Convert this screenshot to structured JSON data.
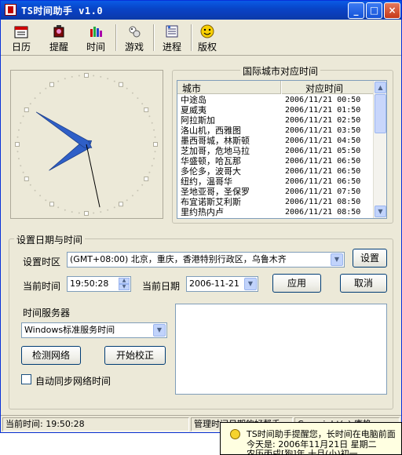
{
  "window": {
    "title": "TS时间助手  v1.0"
  },
  "title_buttons": {
    "minimize": "_",
    "maximize": "□",
    "close": "×"
  },
  "toolbar": [
    {
      "id": "calendar",
      "label": "日历",
      "icon": "calendar-icon"
    },
    {
      "id": "remind",
      "label": "提醒",
      "icon": "alarm-icon"
    },
    {
      "id": "time",
      "label": "时间",
      "icon": "bar-chart-icon"
    },
    {
      "id": "game",
      "label": "游戏",
      "icon": "game-icon"
    },
    {
      "id": "process",
      "label": "进程",
      "icon": "process-icon"
    },
    {
      "id": "copyright",
      "label": "版权",
      "icon": "smiley-icon"
    }
  ],
  "world_clock": {
    "title": "国际城市对应时间",
    "col_city": "城市",
    "col_time": "对应时间",
    "rows": [
      {
        "city": "中途岛",
        "time": "2006/11/21  00:50"
      },
      {
        "city": "夏威夷",
        "time": "2006/11/21  01:50"
      },
      {
        "city": "阿拉斯加",
        "time": "2006/11/21  02:50"
      },
      {
        "city": "洛山机，西雅图",
        "time": "2006/11/21  03:50"
      },
      {
        "city": "墨西哥城，林斯顿",
        "time": "2006/11/21  04:50"
      },
      {
        "city": "芝加哥，危地马拉",
        "time": "2006/11/21  05:50"
      },
      {
        "city": "华盛顿，哈瓦那",
        "time": "2006/11/21  06:50"
      },
      {
        "city": "多伦多，波哥大",
        "time": "2006/11/21  06:50"
      },
      {
        "city": "纽约，温哥华",
        "time": "2006/11/21  06:50"
      },
      {
        "city": "圣地亚哥，圣保罗",
        "time": "2006/11/21  07:50"
      },
      {
        "city": "布宜诺斯艾利斯",
        "time": "2006/11/21  08:50"
      },
      {
        "city": "里约热内卢",
        "time": "2006/11/21  08:50"
      }
    ]
  },
  "settings": {
    "title": "设置日期与时间",
    "timezone_label": "设置时区",
    "timezone_value": "(GMT+08:00) 北京，重庆，香港特别行政区，乌鲁木齐",
    "set_button": "设置",
    "current_time_label": "当前时间",
    "current_time_value": "19:50:28",
    "current_date_label": "当前日期",
    "current_date_value": "2006-11-21",
    "apply_button": "应用",
    "cancel_button": "取消",
    "server_label": "时间服务器",
    "server_value": "Windows标准服务时间",
    "detect_button": "检测网络",
    "start_button": "开始校正",
    "autosync_label": "自动同步网络时间"
  },
  "clock": {
    "hour": 7,
    "minute": 50,
    "second": 28
  },
  "status": {
    "current_time": "当前时间:  19:50:28",
    "help": "管理时间日期的好帮手",
    "copyright": "Copyright(c) 唐艳"
  },
  "tooltip": {
    "line1": "TS时间助手提醒您，长时间在电脑前面",
    "line2": "今天是:  2006年11月21日  星期二",
    "line3": "农历丙戌[狗]年  十月(小)初一"
  }
}
